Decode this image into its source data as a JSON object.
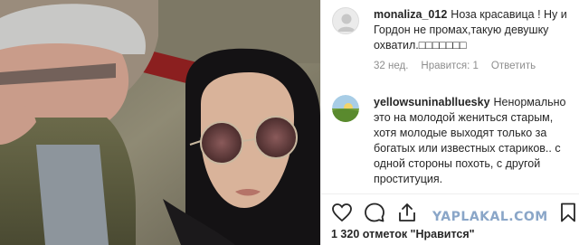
{
  "comments": [
    {
      "username": "monaliza_012",
      "text": "Ноза красавица ! Ну и Гордон не промах,такую девушку охватил.□□□□□□□",
      "time": "32 нед.",
      "likes": "Нравится: 1",
      "reply": "Ответить"
    },
    {
      "username": "yellowsuninablluesky",
      "text": "Ненормально это на молодой жениться старым, хотя молодые выходят только за богатых или известных стариков.. с одной стороны похоть, с другой проституция."
    }
  ],
  "actions": {
    "like": "heart-icon",
    "comment": "comment-icon",
    "share": "share-icon",
    "save": "bookmark-icon"
  },
  "watermark": "YAPLAKAL.COM",
  "likes_count": "1 320 отметок \"Нравится\""
}
